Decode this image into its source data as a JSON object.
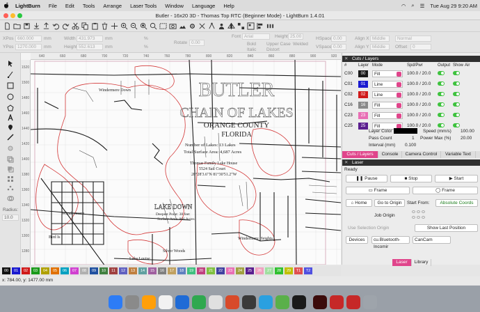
{
  "menubar": {
    "items": [
      "LightBurn",
      "File",
      "Edit",
      "Tools",
      "Arrange",
      "Laser Tools",
      "Window",
      "Language",
      "Help"
    ],
    "date_time": "Tue Aug 29  9:20 AM"
  },
  "window": {
    "title": "Butler - 16x20 3D - Thomas Top RTC (Beginner Mode) - LightBurn 1.4.01"
  },
  "propbar": {
    "xpos_label": "XPos",
    "xpos_value": "660.000",
    "ypos_label": "YPos",
    "ypos_value": "1270.000",
    "width_label": "Width",
    "width_value": "431.973",
    "height_label": "Height",
    "height_value": "552.613",
    "unit_mm": "mm",
    "unit_pct": "%",
    "rotate_label": "Rotate",
    "rotate_value": "0.00",
    "font_label": "Font",
    "font_value": "Arial",
    "text_height_label": "Height",
    "text_height_value": "25.00",
    "bold_label": "Bold",
    "italic_label": "Italic",
    "uppercase_label": "Upper Case",
    "distort_label": "Distort",
    "welded_label": "Welded",
    "hspace_label": "HSpace",
    "hspace_value": "0.00",
    "vspace_label": "VSpace",
    "vspace_value": "0.00",
    "alignx_label": "Align X",
    "alignx_value": "Middle",
    "aligny_label": "Align Y",
    "aligny_value": "Middle",
    "normal_value": "Normal",
    "offset_label": "Offset",
    "offset_value": "0"
  },
  "ruler": {
    "h": [
      "640",
      "660",
      "680",
      "700",
      "720",
      "740",
      "760",
      "780",
      "800",
      "820",
      "840",
      "860",
      "880",
      "900",
      "920"
    ],
    "v": [
      "1520",
      "1500",
      "1480",
      "1460",
      "1440",
      "1420",
      "1400",
      "1380",
      "1360",
      "1340",
      "1320",
      "1300",
      "1280"
    ]
  },
  "map": {
    "title_line1": "BUTLER",
    "title_line2": "CHAIN OF LAKES",
    "county": "ORANGE COUNTY",
    "state": "FLORIDA",
    "lakes_count": "Number of Lakes: 13 Lakes",
    "surface": "Total Surface Area: 4,687 Acres",
    "house_name": "Thomas Family Lake House",
    "house_addr": "5524 Sail Court",
    "house_coords": "28°28'3.6\"N  81°30'51.2\"W",
    "lake_down": "LAKE DOWN",
    "deepest": "Deepest Point: 38 feet",
    "area": "Surface Area: 866 Acres",
    "windermere_down": "Windermere Down",
    "windermere": "Windermere",
    "bird_is": "Bird Is",
    "lake_louise": "Lake Louise",
    "silver_woods": "Silver Woods",
    "windermere_heights": "Windermere Heights"
  },
  "cuts": {
    "panel_title": "Cuts / Layers",
    "headers": [
      "#",
      "Layer",
      "Mode",
      "Spd/Pwr",
      "Output",
      "Show",
      "Air"
    ],
    "rows": [
      {
        "num": "C00",
        "layer": "00",
        "color": "#1a1a1a",
        "mode": "Fill",
        "spd": "100.0 / 20.0"
      },
      {
        "num": "C01",
        "layer": "01",
        "color": "#1a1ad0",
        "mode": "Line",
        "spd": "100.0 / 20.0"
      },
      {
        "num": "C02",
        "layer": "02",
        "color": "#d01a1a",
        "mode": "Line",
        "spd": "100.0 / 20.0"
      },
      {
        "num": "C16",
        "layer": "16",
        "color": "#8a8a8a",
        "mode": "Fill",
        "spd": "100.0 / 20.0"
      },
      {
        "num": "C23",
        "layer": "23",
        "color": "#e86fb5",
        "mode": "Fill",
        "spd": "100.0 / 20.0"
      },
      {
        "num": "C25",
        "layer": "25",
        "color": "#5a1e8f",
        "mode": "Fill",
        "spd": "100.0 / 20.0"
      }
    ],
    "layer_color_label": "Layer Color",
    "pass_count_label": "Pass Count",
    "pass_count_value": "1",
    "interval_label": "Interval (mm)",
    "interval_value": "0.100",
    "speed_label": "Speed (mm/s)",
    "speed_value": "100.00",
    "power_label": "Power Max (%)",
    "power_value": "20.00",
    "tabs": [
      "Cuts / Layers",
      "Console",
      "Camera Control",
      "Variable Text"
    ]
  },
  "laser": {
    "panel_title": "Laser",
    "status": "Ready",
    "pause": "Pause",
    "stop": "Stop",
    "start": "Start",
    "frame1": "Frame",
    "frame2": "Frame",
    "home": "Home",
    "goto_origin": "Go to Origin",
    "start_from_label": "Start From:",
    "start_from_value": "Absolute Coords",
    "job_origin_label": "Job Origin",
    "use_selection_origin": "Use Selection Origin",
    "show_last_position": "Show Last Position",
    "devices": "Devices",
    "device_value": "cu.Bluetooth-Incomir",
    "cam_value": "CanCam",
    "tabs": [
      "Laser",
      "Library"
    ]
  },
  "toolbox": {
    "radius_label": "Radius:",
    "radius_value": "10.0"
  },
  "palette": [
    {
      "label": "00",
      "color": "#111111"
    },
    {
      "label": "01",
      "color": "#1a1ad0"
    },
    {
      "label": "02",
      "color": "#d01a1a"
    },
    {
      "label": "03",
      "color": "#1a9a1a"
    },
    {
      "label": "04",
      "color": "#b0a000"
    },
    {
      "label": "05",
      "color": "#e07000"
    },
    {
      "label": "06",
      "color": "#00a0c0"
    },
    {
      "label": "07",
      "color": "#d040d0"
    },
    {
      "label": "08",
      "color": "#b0b0b0"
    },
    {
      "label": "09",
      "color": "#2050a0"
    },
    {
      "label": "10",
      "color": "#408040"
    },
    {
      "label": "11",
      "color": "#a04040"
    },
    {
      "label": "12",
      "color": "#6060c0"
    },
    {
      "label": "13",
      "color": "#c08040"
    },
    {
      "label": "14",
      "color": "#60a0a0"
    },
    {
      "label": "15",
      "color": "#a060a0"
    },
    {
      "label": "16",
      "color": "#808080"
    },
    {
      "label": "17",
      "color": "#c0a060"
    },
    {
      "label": "18",
      "color": "#6080c0"
    },
    {
      "label": "19",
      "color": "#40c080"
    },
    {
      "label": "20",
      "color": "#c04080"
    },
    {
      "label": "21",
      "color": "#80c040"
    },
    {
      "label": "22",
      "color": "#4040a0"
    },
    {
      "label": "23",
      "color": "#e86fb5"
    },
    {
      "label": "24",
      "color": "#a0a040"
    },
    {
      "label": "25",
      "color": "#5a1e8f"
    },
    {
      "label": "26",
      "color": "#f0a0c0"
    },
    {
      "label": "27",
      "color": "#a0e0a0"
    },
    {
      "label": "28",
      "color": "#30c030"
    },
    {
      "label": "29",
      "color": "#c0c000"
    },
    {
      "label": "T1",
      "color": "#e05050"
    },
    {
      "label": "T2",
      "color": "#5050e0"
    }
  ],
  "status": {
    "coords": "x: 784.00, y: 1477.00 mm"
  }
}
